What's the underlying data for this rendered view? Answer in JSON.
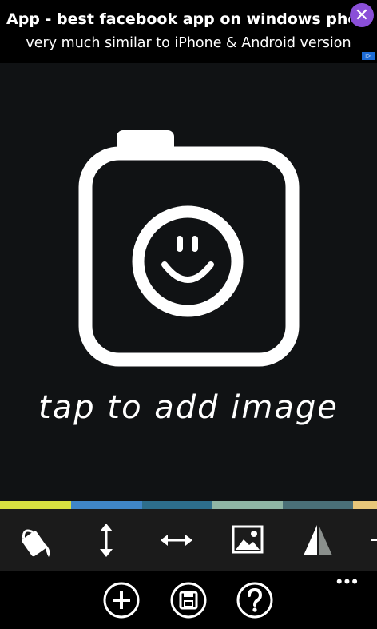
{
  "ad": {
    "title": "App - best  facebook app on windows phone s",
    "subtitle": "very much similar to iPhone & Android version",
    "close_glyph": "✕",
    "badge_glyph": "▷"
  },
  "canvas": {
    "prompt": "tap to add image",
    "background": "#101214"
  },
  "color_strip": [
    "#d9e141",
    "#3f86c8",
    "#2d6e8c",
    "#8fb5a4",
    "#4a6f77",
    "#e8c77a"
  ],
  "tools": [
    {
      "name": "paint-bucket-icon"
    },
    {
      "name": "vertical-resize-icon"
    },
    {
      "name": "horizontal-resize-icon"
    },
    {
      "name": "image-icon"
    },
    {
      "name": "mirror-icon"
    }
  ],
  "appbar": {
    "buttons": [
      "add-icon",
      "save-icon",
      "help-icon"
    ],
    "more_glyph": "•••"
  }
}
